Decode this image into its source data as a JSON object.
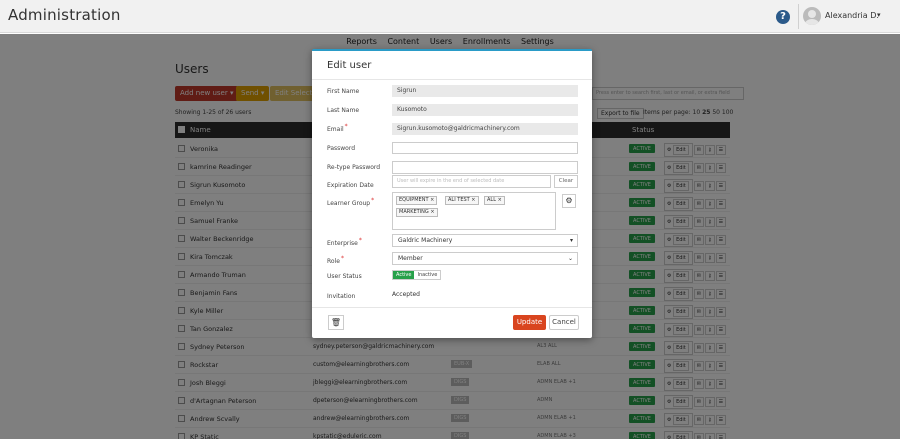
{
  "app": {
    "title": "Administration",
    "help_icon": "question-circle-icon",
    "user_name": "Alexandria D.",
    "user_caret": "▾"
  },
  "subnav": [
    "Reports",
    "Content",
    "Users",
    "Enrollments",
    "Settings"
  ],
  "page": {
    "heading": "Users",
    "add_user": "Add new user ▾",
    "send": "Send ▾",
    "edit_selected": "Edit Selected",
    "showing": "Showing 1-25 of 26 users",
    "search_placeholder": "Press enter to search first, last or email, or extra field",
    "export": "Export to file",
    "per_page_label": "Items per page:",
    "per_page_options": [
      "10",
      "25",
      "50",
      "100"
    ],
    "col_name": "Name",
    "col_status": "Status",
    "active_label": "ACTIVE",
    "edit_label": "Edit"
  },
  "rows": [
    {
      "name": "Veronika",
      "email": "",
      "tag": "",
      "roles": ""
    },
    {
      "name": "kamrine Readinger",
      "email": "",
      "tag": "",
      "roles": ""
    },
    {
      "name": "Sigrun Kusomoto",
      "email": "",
      "tag": "",
      "roles": ""
    },
    {
      "name": "Emelyn Yu",
      "email": "",
      "tag": "",
      "roles": ""
    },
    {
      "name": "Samuel Franke",
      "email": "",
      "tag": "",
      "roles": ""
    },
    {
      "name": "Walter Beckenridge",
      "email": "",
      "tag": "",
      "roles": ""
    },
    {
      "name": "Kira Tomczak",
      "email": "",
      "tag": "",
      "roles": ""
    },
    {
      "name": "Armando Truman",
      "email": "",
      "tag": "",
      "roles": ""
    },
    {
      "name": "Benjamin Fans",
      "email": "",
      "tag": "",
      "roles": ""
    },
    {
      "name": "Kyle Miller",
      "email": "",
      "tag": "",
      "roles": ""
    },
    {
      "name": "Tan Gonzalez",
      "email": "",
      "tag": "",
      "roles": ""
    },
    {
      "name": "Sydney Peterson",
      "email": "sydney.peterson@galdricmachinery.com",
      "tag": "",
      "roles": "AL3   ALL"
    },
    {
      "name": "Rockstar",
      "email": "custom@elearningbrothers.com",
      "tag": "EUB-X",
      "roles": "ELAB   ALL"
    },
    {
      "name": "Josh Bleggi",
      "email": "jbleggi@elearningbrothers.com",
      "tag": "DIGS",
      "roles": "ADMN   ELAB   +1"
    },
    {
      "name": "d'Artagnan Peterson",
      "email": "dpeterson@elearningbrothers.com",
      "tag": "DIGS",
      "roles": "ADMN"
    },
    {
      "name": "Andrew Scvally",
      "email": "andrew@elearningbrothers.com",
      "tag": "DIGS",
      "roles": "ADMN   ELAB   +1"
    },
    {
      "name": "KP Static",
      "email": "kpstatic@eduleric.com",
      "tag": "DIGS",
      "roles": "ADMN   ELAB   +3"
    }
  ],
  "modal": {
    "title": "Edit user",
    "first_name_label": "First Name",
    "first_name": "Sigrun",
    "last_name_label": "Last Name",
    "last_name": "Kusomoto",
    "email_label": "Email",
    "email": "Sigrun.kusomoto@galdricmachinery.com",
    "password_label": "Password",
    "retype_label": "Re-type Password",
    "expiration_label": "Expiration Date",
    "expiration_placeholder": "User will expire in the end of selected date",
    "clear": "Clear",
    "learner_group_label": "Learner Group",
    "groups": [
      "EQUIPMENT ×",
      "ALI TEST ×",
      "ALL ×",
      "MARKETING ×"
    ],
    "enterprise_label": "Enterprise",
    "enterprise": "Galdric Machinery",
    "role_label": "Role",
    "role": "Member",
    "status_label": "User Status",
    "status_active": "Active",
    "status_inactive": "Inactive",
    "invitation_label": "Invitation",
    "invitation": "Accepted",
    "update": "Update",
    "cancel": "Cancel",
    "required_mark": "*"
  }
}
